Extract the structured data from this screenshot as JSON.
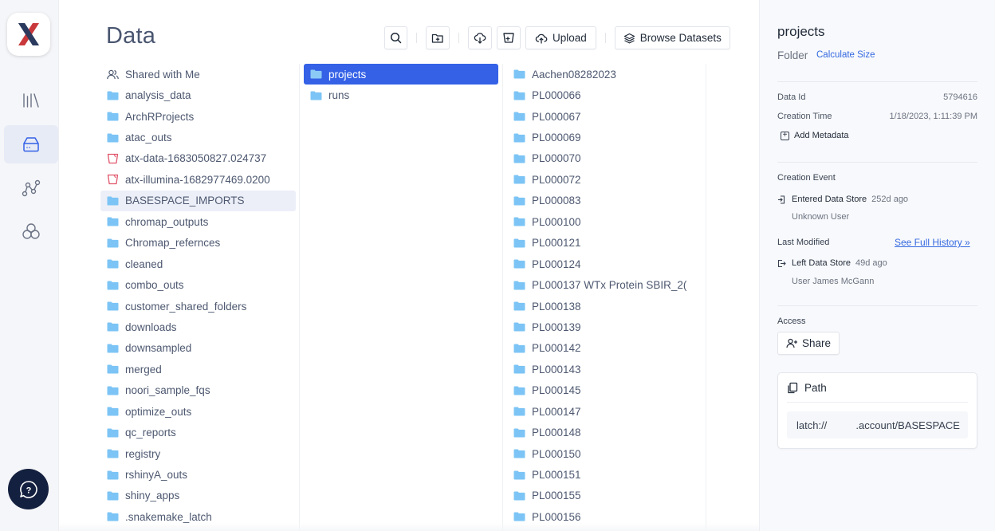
{
  "app": {
    "logo_icon": "latch-x-logo",
    "nav": [
      {
        "name": "library",
        "icon": "library-icon",
        "active": false
      },
      {
        "name": "data",
        "icon": "drive-icon",
        "active": true
      },
      {
        "name": "workflows",
        "icon": "workflow-graph-icon",
        "active": false
      },
      {
        "name": "registry",
        "icon": "hexagons-icon",
        "active": false
      }
    ],
    "help_icon": "help-chat-icon"
  },
  "header": {
    "title": "Data",
    "toolbar": {
      "search_icon": "search-icon",
      "new_folder_icon": "folder-plus-icon",
      "download_icon": "cloud-download-icon",
      "bucket_icon": "bucket-add-icon",
      "upload_label": "Upload",
      "browse_datasets_label": "Browse Datasets"
    }
  },
  "columns": {
    "col1": [
      {
        "label": "Shared with Me",
        "icon": "users-icon"
      },
      {
        "label": "analysis_data",
        "icon": "folder-icon"
      },
      {
        "label": "ArchRProjects",
        "icon": "folder-icon"
      },
      {
        "label": "atac_outs",
        "icon": "folder-icon"
      },
      {
        "label": "atx-data-1683050827.024737",
        "icon": "bucket-icon"
      },
      {
        "label": "atx-illumina-1682977469.0200",
        "icon": "bucket-icon"
      },
      {
        "label": "BASESPACE_IMPORTS",
        "icon": "folder-icon",
        "state": "hover"
      },
      {
        "label": "chromap_outputs",
        "icon": "folder-icon"
      },
      {
        "label": "Chromap_refernces",
        "icon": "folder-icon"
      },
      {
        "label": "cleaned",
        "icon": "folder-icon"
      },
      {
        "label": "combo_outs",
        "icon": "folder-icon"
      },
      {
        "label": "customer_shared_folders",
        "icon": "folder-icon"
      },
      {
        "label": "downloads",
        "icon": "folder-icon"
      },
      {
        "label": "downsampled",
        "icon": "folder-icon"
      },
      {
        "label": "merged",
        "icon": "folder-icon"
      },
      {
        "label": "noori_sample_fqs",
        "icon": "folder-icon"
      },
      {
        "label": "optimize_outs",
        "icon": "folder-icon"
      },
      {
        "label": "qc_reports",
        "icon": "folder-icon"
      },
      {
        "label": "registry",
        "icon": "folder-icon"
      },
      {
        "label": "rshinyA_outs",
        "icon": "folder-icon"
      },
      {
        "label": "shiny_apps",
        "icon": "folder-icon"
      },
      {
        "label": ".snakemake_latch",
        "icon": "folder-icon"
      }
    ],
    "col2": [
      {
        "label": "projects",
        "icon": "folder-icon",
        "state": "selected"
      },
      {
        "label": "runs",
        "icon": "folder-icon"
      }
    ],
    "col3": [
      {
        "label": "Aachen08282023",
        "icon": "folder-icon"
      },
      {
        "label": "PL000066",
        "icon": "folder-icon"
      },
      {
        "label": "PL000067",
        "icon": "folder-icon"
      },
      {
        "label": "PL000069",
        "icon": "folder-icon"
      },
      {
        "label": "PL000070",
        "icon": "folder-icon"
      },
      {
        "label": "PL000072",
        "icon": "folder-icon"
      },
      {
        "label": "PL000083",
        "icon": "folder-icon"
      },
      {
        "label": "PL000100",
        "icon": "folder-icon"
      },
      {
        "label": "PL000121",
        "icon": "folder-icon"
      },
      {
        "label": "PL000124",
        "icon": "folder-icon"
      },
      {
        "label": "PL000137 WTx Protein SBIR_2(",
        "icon": "folder-icon"
      },
      {
        "label": "PL000138",
        "icon": "folder-icon"
      },
      {
        "label": "PL000139",
        "icon": "folder-icon"
      },
      {
        "label": "PL000142",
        "icon": "folder-icon"
      },
      {
        "label": "PL000143",
        "icon": "folder-icon"
      },
      {
        "label": "PL000145",
        "icon": "folder-icon"
      },
      {
        "label": "PL000147",
        "icon": "folder-icon"
      },
      {
        "label": "PL000148",
        "icon": "folder-icon"
      },
      {
        "label": "PL000150",
        "icon": "folder-icon"
      },
      {
        "label": "PL000151",
        "icon": "folder-icon"
      },
      {
        "label": "PL000155",
        "icon": "folder-icon"
      },
      {
        "label": "PL000156",
        "icon": "folder-icon"
      }
    ]
  },
  "details": {
    "name": "projects",
    "type": "Folder",
    "calculate_size_label": "Calculate Size",
    "data_id_label": "Data Id",
    "data_id": "5794616",
    "creation_time_label": "Creation Time",
    "creation_time": "1/18/2023, 1:11:39 PM",
    "add_metadata_label": "Add Metadata",
    "creation_event_label": "Creation Event",
    "creation_event": {
      "action": "Entered Data Store",
      "ago": "252d ago",
      "user": "Unknown User"
    },
    "last_modified_label": "Last Modified",
    "see_history_label": "See Full History »",
    "last_modified": {
      "action": "Left Data Store",
      "ago": "49d ago",
      "user": "User James McGann"
    },
    "access_label": "Access",
    "share_label": "Share",
    "path_label": "Path",
    "path_value": "latch://          .account/BASESPACE"
  },
  "colors": {
    "accent": "#3461e6",
    "link": "#3469e0",
    "folder": "#7cc4f5",
    "bucket": "#e0556b",
    "help_button": "#14203f"
  }
}
